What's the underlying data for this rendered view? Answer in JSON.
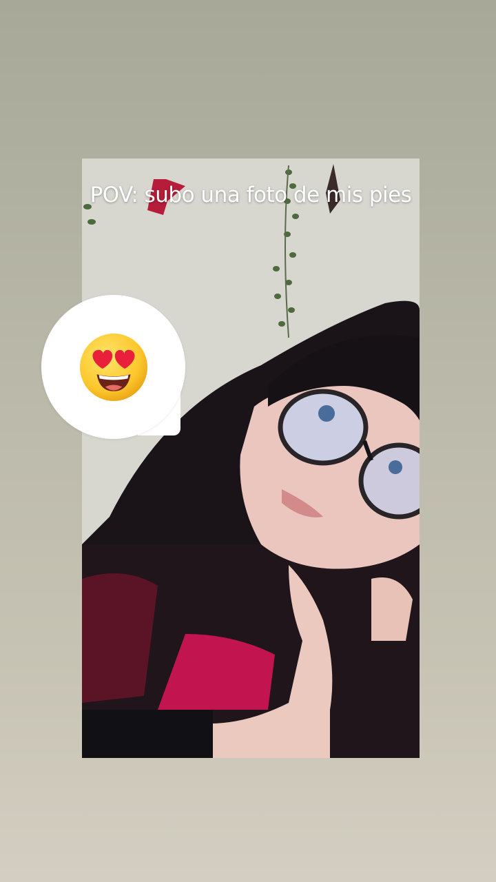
{
  "story": {
    "caption": "POV: subo una foto de mis pies",
    "reaction": {
      "icon": "heart-eyes-emoji-icon"
    }
  },
  "colors": {
    "background_top": "#a7a898",
    "background_bottom": "#d3cec1",
    "caption_text": "#ffffff"
  }
}
